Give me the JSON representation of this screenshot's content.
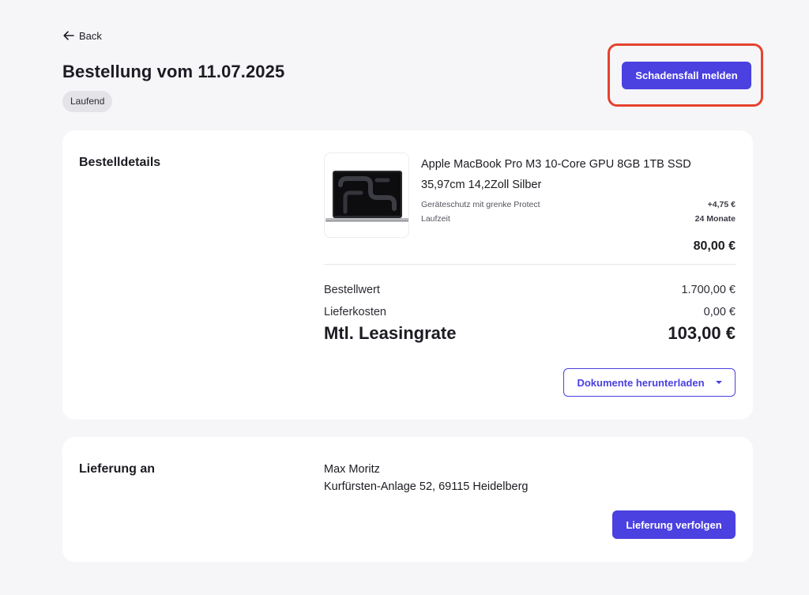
{
  "nav": {
    "back_label": "Back"
  },
  "header": {
    "title": "Bestellung vom 11.07.2025",
    "status": "Laufend",
    "damage_button": "Schadensfall melden"
  },
  "details": {
    "section_title": "Bestelldetails",
    "product": {
      "name": "Apple MacBook Pro M3 10-Core GPU 8GB 1TB SSD 35,97cm 14,2Zoll Silber",
      "image_icon": "laptop-product-image",
      "options": [
        {
          "label": "Geräteschutz mit grenke Protect",
          "value": "+4,75 €"
        },
        {
          "label": "Laufzeit",
          "value": "24 Monate"
        }
      ],
      "price": "80,00 €"
    },
    "summary": {
      "order_value_label": "Bestellwert",
      "order_value": "1.700,00 €",
      "shipping_label": "Lieferkosten",
      "shipping_value": "0,00 €",
      "monthly_label": "Mtl. Leasingrate",
      "monthly_value": "103,00 €"
    },
    "documents_button": "Dokumente herunterladen"
  },
  "delivery": {
    "section_title": "Lieferung an",
    "name": "Max Moritz",
    "address": "Kurfürsten-Anlage 52, 69115 Heidelberg",
    "track_button": "Lieferung verfolgen"
  },
  "colors": {
    "accent": "#4b40e0",
    "highlight": "#e5432e",
    "background": "#f6f6f8"
  }
}
